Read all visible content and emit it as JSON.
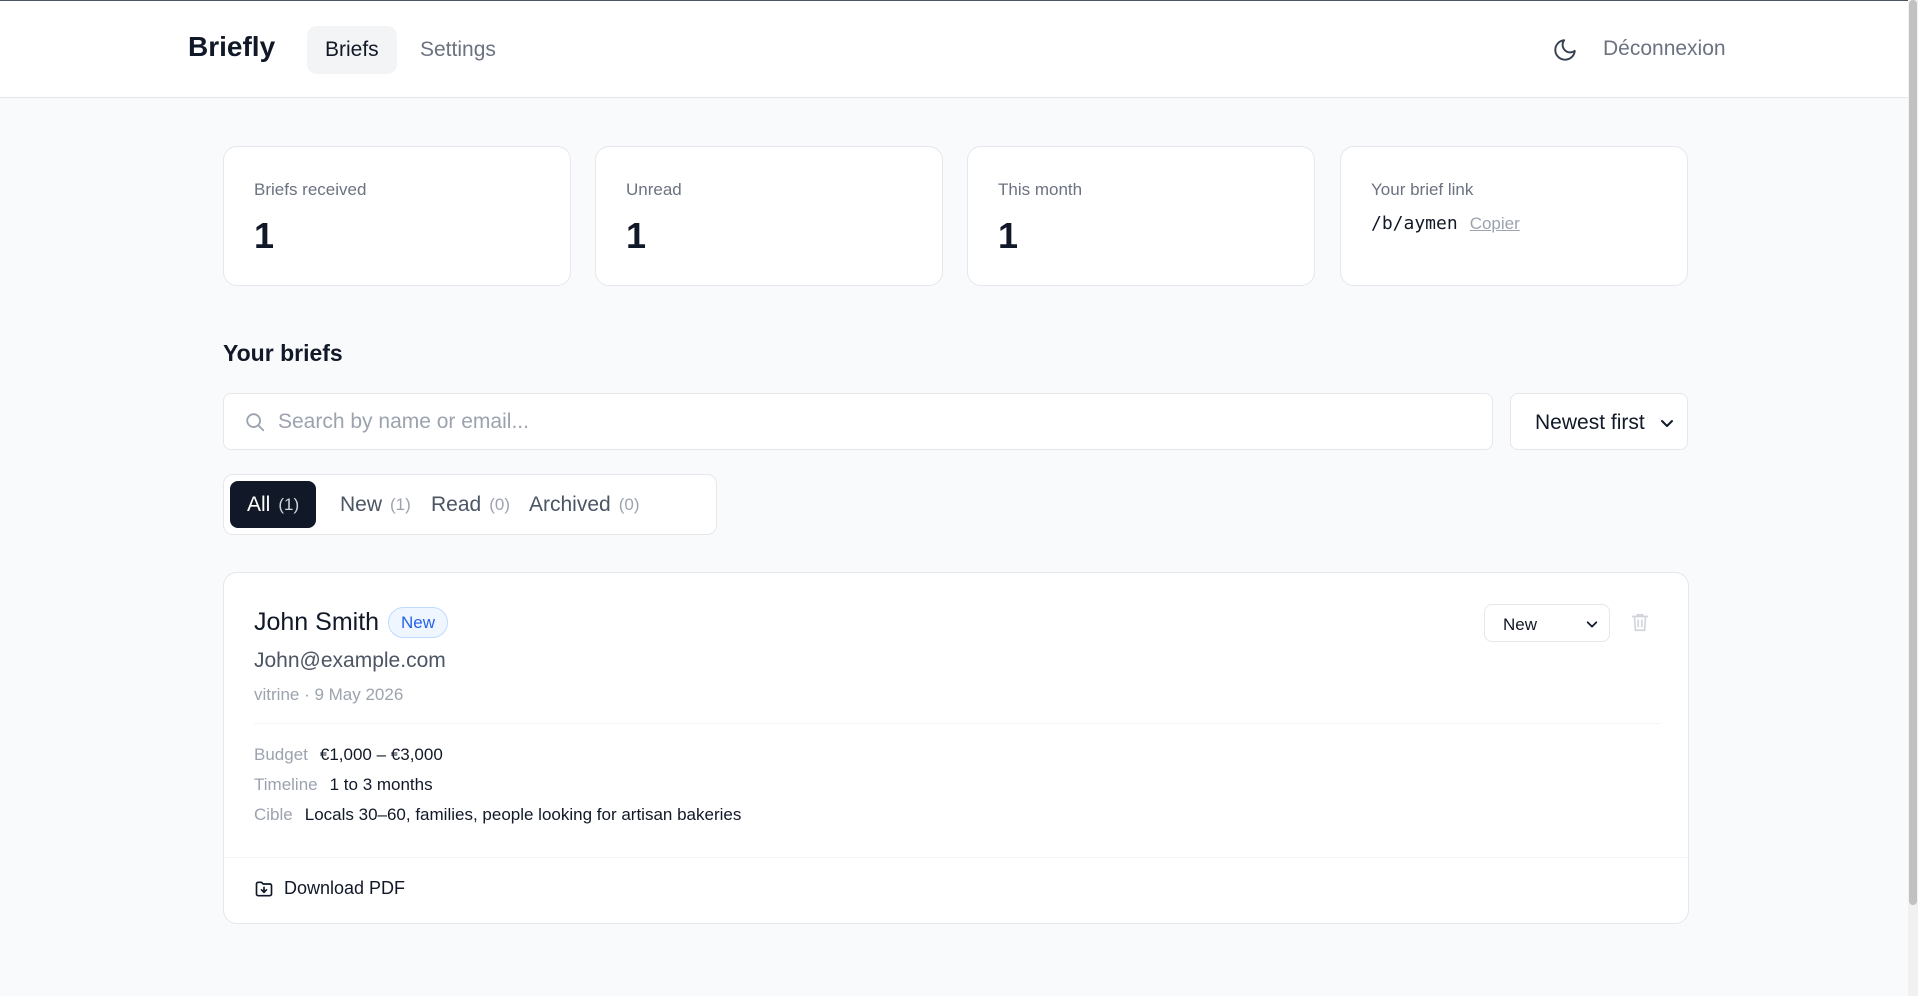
{
  "header": {
    "brand": "Briefly",
    "nav": {
      "briefs": "Briefs",
      "settings": "Settings"
    },
    "theme_icon": "moon-icon",
    "logout": "Déconnexion"
  },
  "stats": {
    "received": {
      "label": "Briefs received",
      "value": "1"
    },
    "unread": {
      "label": "Unread",
      "value": "1"
    },
    "month": {
      "label": "This month",
      "value": "1"
    },
    "link": {
      "label": "Your brief link",
      "path": "/b/aymen",
      "copy": "Copier"
    }
  },
  "briefs_section": {
    "title": "Your briefs",
    "search": {
      "placeholder": "Search by name or email...",
      "value": ""
    },
    "sort": {
      "selected": "Newest first"
    },
    "filters": [
      {
        "label": "All",
        "count": "(1)",
        "active": true
      },
      {
        "label": "New",
        "count": "(1)",
        "active": false
      },
      {
        "label": "Read",
        "count": "(0)",
        "active": false
      },
      {
        "label": "Archived",
        "count": "(0)",
        "active": false
      }
    ]
  },
  "brief": {
    "name": "John Smith",
    "badge": "New",
    "email": "John@example.com",
    "meta": "vitrine · 9 May 2026",
    "status": "New",
    "details": {
      "budget": {
        "key": "Budget",
        "value": "€1,000 – €3,000"
      },
      "timeline": {
        "key": "Timeline",
        "value": "1 to 3 months"
      },
      "target": {
        "key": "Cible",
        "value": "Locals 30–60, families, people looking for artisan bakeries"
      }
    },
    "download": "Download PDF"
  },
  "colors": {
    "background": "#f9fafb",
    "accent_dark": "#111827",
    "badge_blue": "#2563eb",
    "muted": "#9ca3af"
  }
}
